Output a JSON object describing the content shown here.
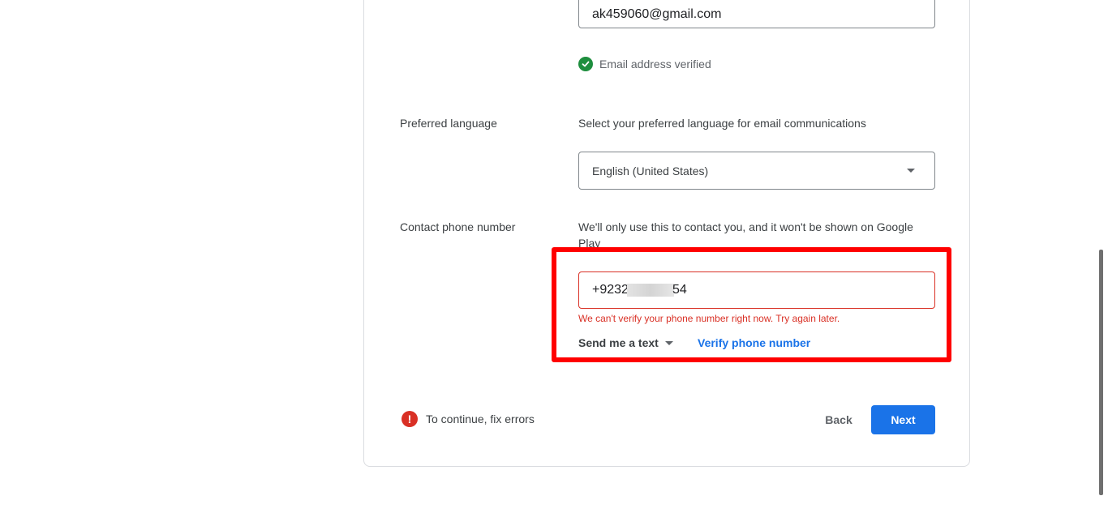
{
  "email": {
    "value": "ak459060@gmail.com",
    "verified_text": "Email address verified"
  },
  "language": {
    "label": "Preferred language",
    "description": "Select your preferred language for email communications",
    "selected": "English (United States)"
  },
  "phone": {
    "label": "Contact phone number",
    "description": "We'll only use this to contact you, and it won't be shown on Google Play",
    "value_prefix": "+9232",
    "value_suffix": "54",
    "error": "We can't verify your phone number right now. Try again later.",
    "send_method": "Send me a text",
    "verify_label": "Verify phone number"
  },
  "footer": {
    "error_summary": "To continue, fix errors",
    "back_label": "Back",
    "next_label": "Next"
  },
  "colors": {
    "accent": "#1a73e8",
    "error": "#d93025",
    "success": "#1e8e3e",
    "highlight": "#ff0000"
  },
  "icons": {
    "verified": "check-circle-icon",
    "dropdown": "chevron-down-icon",
    "error": "error-icon"
  }
}
